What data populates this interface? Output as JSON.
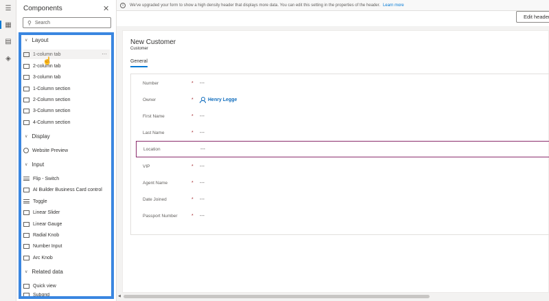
{
  "panel": {
    "title": "Components",
    "search_placeholder": "Search"
  },
  "groups": [
    {
      "label": "Layout",
      "items": [
        "1-column tab",
        "2-column tab",
        "3-column tab",
        "1-Column section",
        "2-Column section",
        "3-Column section",
        "4-Column section"
      ]
    },
    {
      "label": "Display",
      "items": [
        "Website Preview"
      ]
    },
    {
      "label": "Input",
      "items": [
        "Flip - Switch",
        "AI Builder Business Card control",
        "Toggle",
        "Linear Slider",
        "Linear Gauge",
        "Radial Knob",
        "Number Input",
        "Arc Knob"
      ]
    },
    {
      "label": "Related data",
      "items": [
        "Quick view",
        "Subgrid"
      ]
    }
  ],
  "more_glyph": "···",
  "infobar": {
    "message": "We've upgraded your form to show a high density header that displays more data. You can edit this setting in the properties of the header.",
    "link": "Learn more"
  },
  "toolbar": {
    "edit_header": "Edit header"
  },
  "form": {
    "title": "New Customer",
    "subtitle": "Customer",
    "tab": "General",
    "fields": [
      {
        "label": "Number",
        "required": "*",
        "value": "---"
      },
      {
        "label": "Owner",
        "required": "*",
        "value": "Henry Legge"
      },
      {
        "label": "First Name",
        "required": "*",
        "value": "---"
      },
      {
        "label": "Last Name",
        "required": "*",
        "value": "---"
      },
      {
        "label": "Location",
        "required": "",
        "value": "---"
      },
      {
        "label": "VIP",
        "required": "*",
        "value": "---"
      },
      {
        "label": "Agent Name",
        "required": "*",
        "value": "---"
      },
      {
        "label": "Date Joined",
        "required": "*",
        "value": "---"
      },
      {
        "label": "Passport Number",
        "required": "*",
        "value": "---"
      }
    ]
  },
  "colors": {
    "accent": "#0078d4",
    "highlight": "#3a86e0",
    "selected_field": "#8a2b6b",
    "link": "#0f6cbd"
  }
}
